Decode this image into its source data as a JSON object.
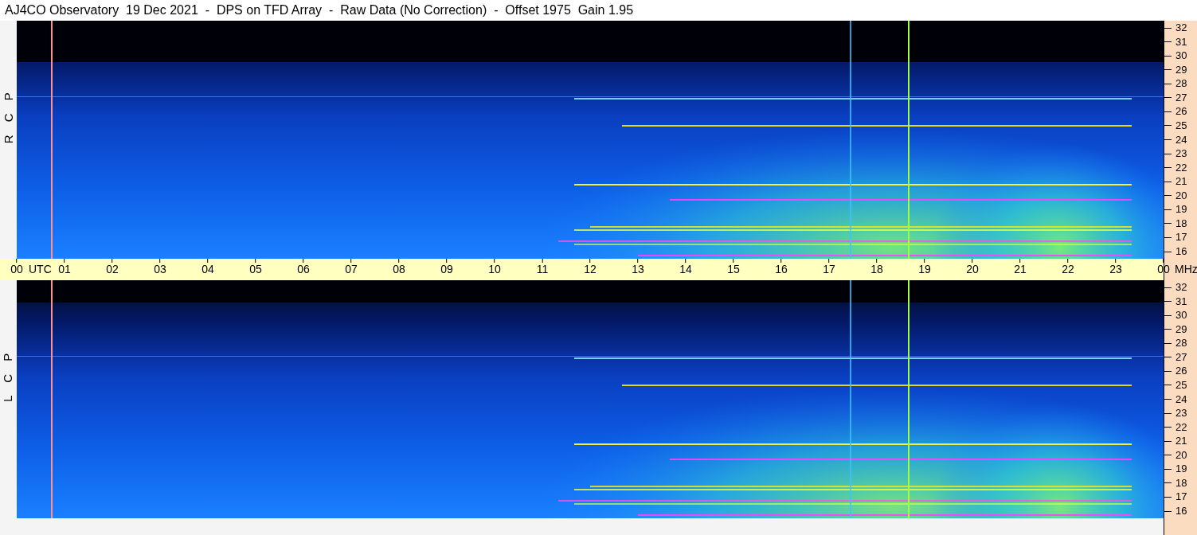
{
  "title": "AJ4CO Observatory  19 Dec 2021  -  DPS on TFD Array  -  Raw Data (No Correction)  -  Offset 1975  Gain 1.95",
  "time_axis": {
    "ticks": [
      "00",
      "01",
      "02",
      "03",
      "04",
      "05",
      "06",
      "07",
      "08",
      "09",
      "10",
      "11",
      "12",
      "13",
      "14",
      "15",
      "16",
      "17",
      "18",
      "19",
      "20",
      "21",
      "22",
      "23",
      "00"
    ],
    "time_unit": "UTC",
    "frequency_unit": "MHz"
  },
  "panels": [
    {
      "label": "R C P",
      "frequency_ticks": [
        "32",
        "31",
        "30",
        "29",
        "28",
        "27",
        "26",
        "25",
        "24",
        "23",
        "22",
        "21",
        "20",
        "19",
        "18",
        "17",
        "16"
      ]
    },
    {
      "label": "L C P",
      "frequency_ticks": [
        "32",
        "31",
        "30",
        "29",
        "28",
        "27",
        "26",
        "25",
        "24",
        "23",
        "22",
        "21",
        "20",
        "19",
        "18",
        "17",
        "16"
      ]
    }
  ]
}
